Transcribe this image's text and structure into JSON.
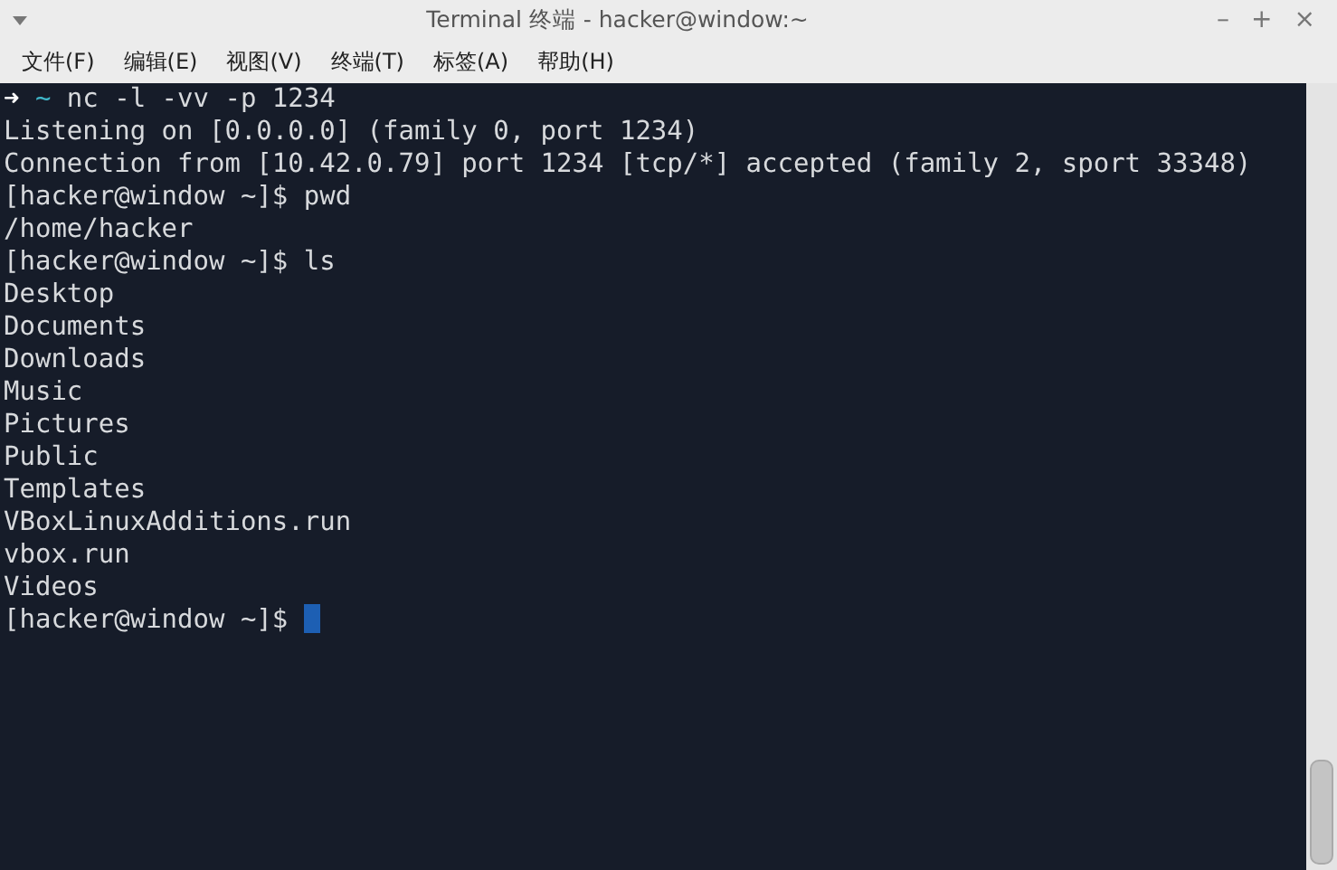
{
  "window": {
    "title": "Terminal 终端 - hacker@window:~",
    "controls": [
      "–",
      "+",
      "×"
    ]
  },
  "menu": [
    "文件(F)",
    "编辑(E)",
    "视图(V)",
    "终端(T)",
    "标签(A)",
    "帮助(H)"
  ],
  "terminal": {
    "lines": [
      {
        "kind": "zsh",
        "arrow": "➜",
        "dir": "~",
        "command": "nc -l -vv -p 1234"
      },
      {
        "kind": "text",
        "text": "Listening on [0.0.0.0] (family 0, port 1234)"
      },
      {
        "kind": "text",
        "text": "Connection from [10.42.0.79] port 1234 [tcp/*] accepted (family 2, sport 33348)"
      },
      {
        "kind": "text",
        "text": "[hacker@window ~]$ pwd"
      },
      {
        "kind": "text",
        "text": "/home/hacker"
      },
      {
        "kind": "text",
        "text": "[hacker@window ~]$ ls"
      },
      {
        "kind": "text",
        "text": "Desktop"
      },
      {
        "kind": "text",
        "text": "Documents"
      },
      {
        "kind": "text",
        "text": "Downloads"
      },
      {
        "kind": "text",
        "text": "Music"
      },
      {
        "kind": "text",
        "text": "Pictures"
      },
      {
        "kind": "text",
        "text": "Public"
      },
      {
        "kind": "text",
        "text": "Templates"
      },
      {
        "kind": "text",
        "text": "VBoxLinuxAdditions.run"
      },
      {
        "kind": "text",
        "text": "vbox.run"
      },
      {
        "kind": "text",
        "text": "Videos"
      },
      {
        "kind": "prompt",
        "text": "[hacker@window ~]$",
        "cursor": true
      }
    ]
  }
}
